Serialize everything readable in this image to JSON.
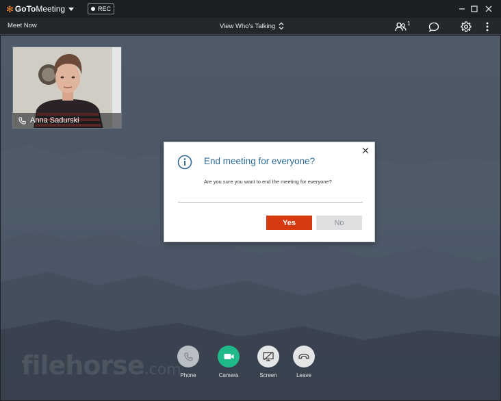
{
  "app": {
    "brand_goto": "GoTo",
    "brand_meeting": "Meeting",
    "rec_label": "REC"
  },
  "menubar": {
    "meet_now": "Meet Now",
    "view_mode": "View Who's Talking",
    "attendee_count": "1"
  },
  "video": {
    "participant_name": "Anna Sadurski"
  },
  "dialog": {
    "title": "End meeting for everyone?",
    "message": "Are you sure you want to end the meeting for everyone?",
    "yes_label": "Yes",
    "no_label": "No"
  },
  "controls": [
    {
      "label": "Phone",
      "icon": "phone-icon",
      "color": "#b9bec4"
    },
    {
      "label": "Camera",
      "icon": "camera-icon",
      "color": "#1fb98a"
    },
    {
      "label": "Screen",
      "icon": "screen-share-off-icon",
      "color": "#e3e5e7"
    },
    {
      "label": "Leave",
      "icon": "hang-up-icon",
      "color": "#e3e5e7"
    }
  ],
  "watermark": {
    "text": "filehorse",
    "suffix": ".com"
  },
  "colors": {
    "brand_orange": "#f68d2e",
    "yes_button": "#d63a10",
    "camera_on": "#1fb98a",
    "dialog_title": "#2e6a94"
  }
}
